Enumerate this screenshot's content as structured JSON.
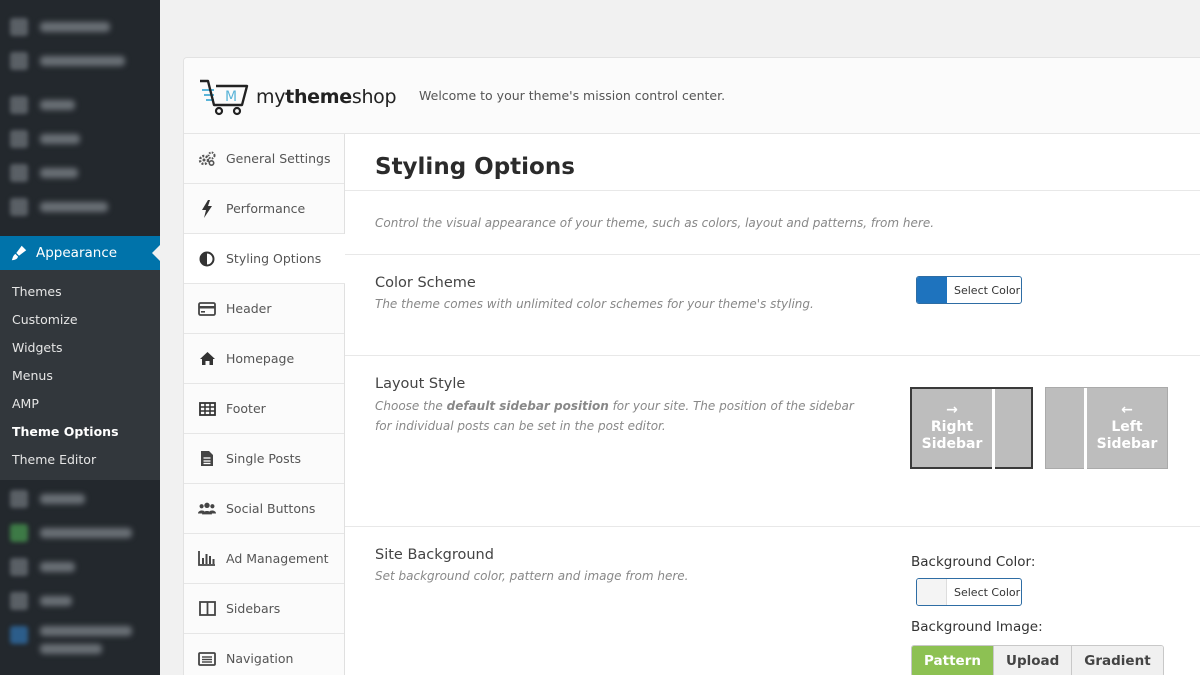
{
  "wp_menu": {
    "appearance_label": "Appearance",
    "submenu": [
      "Themes",
      "Customize",
      "Widgets",
      "Menus",
      "AMP",
      "Theme Options",
      "Theme Editor"
    ],
    "current_submenu": "Theme Options"
  },
  "header": {
    "logo_letter": "M",
    "logo_pre": "my",
    "logo_bold": "theme",
    "logo_post": "shop",
    "welcome": "Welcome to your theme's mission control center."
  },
  "nav": {
    "items": [
      {
        "label": "General Settings",
        "icon": "gears-icon"
      },
      {
        "label": "Performance",
        "icon": "bolt-icon"
      },
      {
        "label": "Styling Options",
        "icon": "adjust-icon"
      },
      {
        "label": "Header",
        "icon": "credit-card-icon"
      },
      {
        "label": "Homepage",
        "icon": "home-icon"
      },
      {
        "label": "Footer",
        "icon": "table-icon"
      },
      {
        "label": "Single Posts",
        "icon": "file-text-icon"
      },
      {
        "label": "Social Buttons",
        "icon": "users-icon"
      },
      {
        "label": "Ad Management",
        "icon": "bar-chart-icon"
      },
      {
        "label": "Sidebars",
        "icon": "columns-icon"
      },
      {
        "label": "Navigation",
        "icon": "list-alt-icon"
      }
    ],
    "active": "Styling Options"
  },
  "content": {
    "title": "Styling Options",
    "description": "Control the visual appearance of your theme, such as colors, layout and patterns, from here.",
    "color_scheme": {
      "title": "Color Scheme",
      "description": "The theme comes with unlimited color schemes for your theme's styling.",
      "button_label": "Select Color",
      "color": "#1e73be"
    },
    "layout_style": {
      "title": "Layout Style",
      "desc_pre": "Choose the ",
      "desc_bold": "default sidebar position",
      "desc_post": " for your site. The position of the sidebar for individual posts can be set in the post editor.",
      "right_arrow": "→",
      "right_line1": "Right",
      "right_line2": "Sidebar",
      "left_arrow": "←",
      "left_line1": "Left",
      "left_line2": "Sidebar",
      "selected": "right"
    },
    "site_background": {
      "title": "Site Background",
      "description": "Set background color, pattern and image from here.",
      "bg_color_label": "Background Color:",
      "button_label": "Select Color",
      "bg_image_label": "Background Image:",
      "tabs": [
        "Pattern",
        "Upload",
        "Gradient"
      ],
      "active_tab": "Pattern"
    }
  },
  "colors": {
    "wp_sidebar": "#23282d",
    "wp_active": "#0073aa",
    "accent_green": "#8dc153",
    "scheme_blue": "#1e73be"
  }
}
